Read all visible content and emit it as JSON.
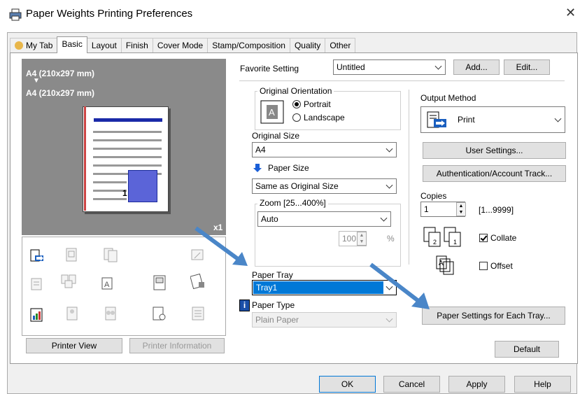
{
  "window": {
    "title": "Paper Weights Printing Preferences",
    "close": "✕"
  },
  "tabs": [
    "My Tab",
    "Basic",
    "Layout",
    "Finish",
    "Cover Mode",
    "Stamp/Composition",
    "Quality",
    "Other"
  ],
  "preview": {
    "original": "A4 (210x297 mm)",
    "arrow": "▼",
    "output": "A4 (210x297 mm)",
    "copies_mark": "x1",
    "page_number": "1"
  },
  "left_buttons": {
    "printer_view": "Printer View",
    "printer_info": "Printer Information"
  },
  "favorite": {
    "label": "Favorite Setting",
    "value": "Untitled",
    "add": "Add...",
    "edit": "Edit..."
  },
  "orientation": {
    "legend": "Original Orientation",
    "portrait": "Portrait",
    "landscape": "Landscape",
    "selected": "Portrait"
  },
  "original_size": {
    "label": "Original Size",
    "value": "A4"
  },
  "paper_size": {
    "label": "Paper Size",
    "value": "Same as Original Size"
  },
  "zoom": {
    "legend": "Zoom [25...400%]",
    "value": "Auto",
    "percent": "100",
    "unit": "%"
  },
  "paper_tray": {
    "label": "Paper Tray",
    "value": "Tray1"
  },
  "paper_type": {
    "label": "Paper Type",
    "value": "Plain Paper",
    "info_icon": "i"
  },
  "output": {
    "label": "Output Method",
    "value": "Print"
  },
  "right_buttons": {
    "user_settings": "User Settings...",
    "auth": "Authentication/Account Track...",
    "paper_settings": "Paper Settings for Each Tray...",
    "default": "Default"
  },
  "copies": {
    "label": "Copies",
    "value": "1",
    "range": "[1...9999]",
    "collate": "Collate",
    "offset": "Offset",
    "collate_checked": true,
    "offset_checked": false
  },
  "footer": {
    "ok": "OK",
    "cancel": "Cancel",
    "apply": "Apply",
    "help": "Help"
  },
  "colors": {
    "accent_blue": "#1a2aa8",
    "annotation_arrow": "#4a86c8",
    "selected_bg": "#0078d7"
  }
}
